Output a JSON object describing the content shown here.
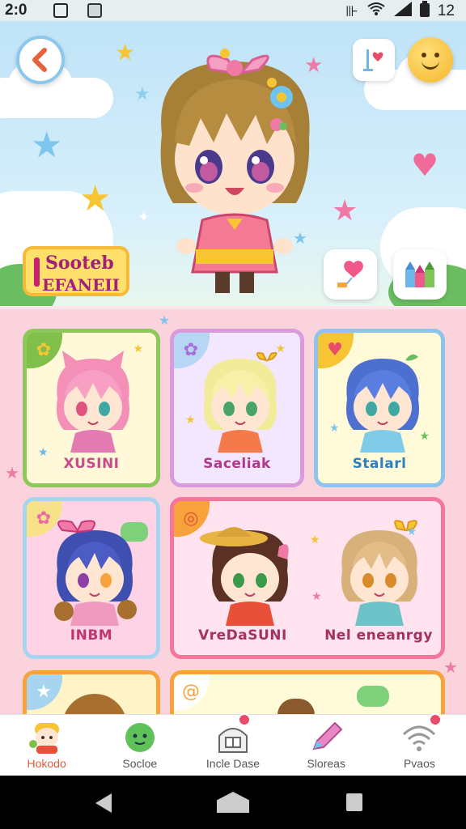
{
  "status_bar": {
    "time": "2:0",
    "battery_text": "12"
  },
  "header": {
    "badge_line1": "Sooteb",
    "badge_line2": "EFANEII",
    "icons": [
      "back-icon",
      "heart-flag-icon",
      "smiley-icon",
      "balloon-icon",
      "blocks-icon"
    ]
  },
  "cards": [
    {
      "label": "XUSINI",
      "color": "#74c044",
      "label_color": "#c84b8a"
    },
    {
      "label": "Saceliak",
      "color": "#d67ad9",
      "label_color": "#b0388a"
    },
    {
      "label": "Stalarl",
      "color": "#6fb7e8",
      "label_color": "#2e7fc2"
    },
    {
      "label": "INBM",
      "color": "#8ccbe9",
      "label_color": "#c0356e"
    },
    {
      "label": "VreDaSUNI",
      "color": "#f2689a",
      "label_color": "#a43161"
    },
    {
      "label": "Nel eneanrgy",
      "color": "#f2689a",
      "label_color": "#a43161"
    }
  ],
  "bottom_nav": [
    {
      "label": "Hokodo",
      "icon": "character-icon",
      "active": true
    },
    {
      "label": "Socloe",
      "icon": "slime-icon",
      "active": false
    },
    {
      "label": "Incle Dase",
      "icon": "house-icon",
      "active": false
    },
    {
      "label": "Sloreas",
      "icon": "pencil-icon",
      "active": false
    },
    {
      "label": "Pvaos",
      "icon": "wifi-icon",
      "active": false
    }
  ],
  "colors": {
    "accent": "#e05b3a",
    "grid_bg": "#fbd3dd",
    "sky": "#bfe3f7"
  }
}
